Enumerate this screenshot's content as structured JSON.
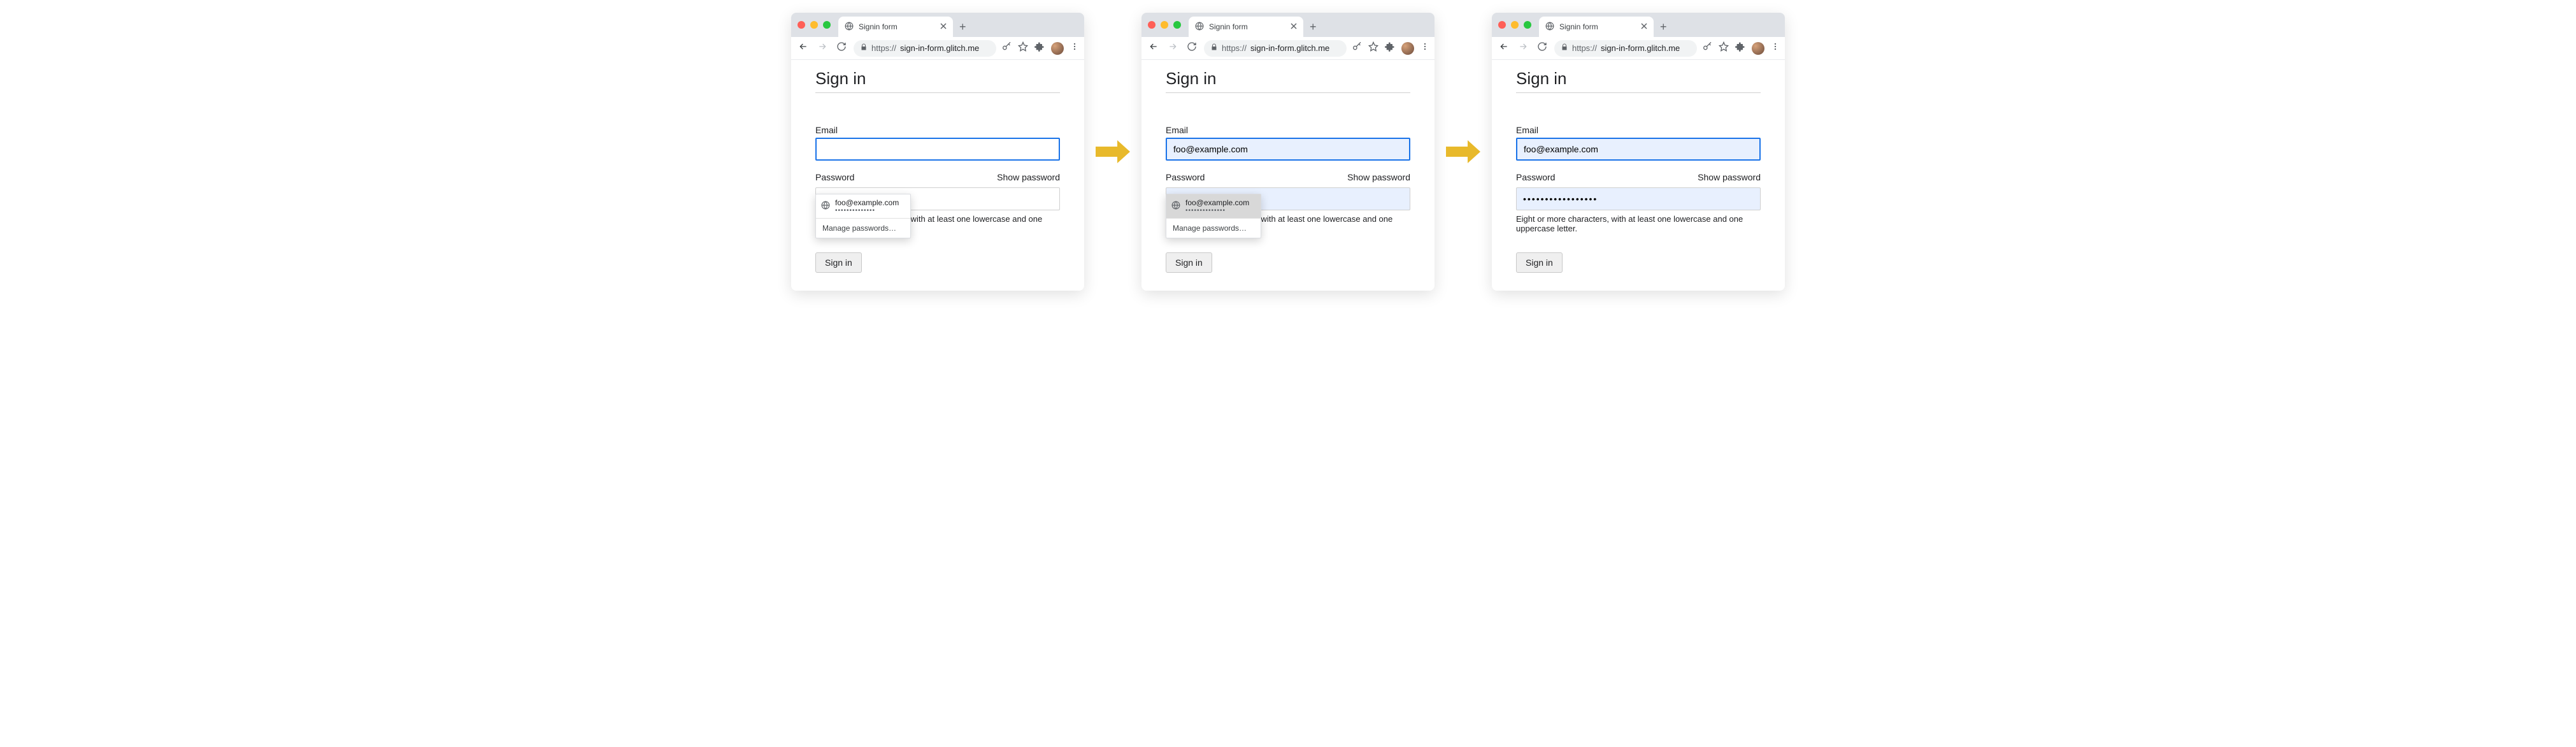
{
  "browser": {
    "tab_title": "Signin form",
    "url_protocol": "https://",
    "url_host": "sign-in-form.glitch.me"
  },
  "page": {
    "heading": "Sign in",
    "email_label": "Email",
    "password_label": "Password",
    "show_password": "Show password",
    "hint": "Eight or more characters, with at least one lowercase and one uppercase letter.",
    "submit_label": "Sign in"
  },
  "autofill": {
    "suggestion_email": "foo@example.com",
    "suggestion_dots": "••••••••••••••",
    "manage_label": "Manage passwords…"
  },
  "state1": {
    "email_value": "",
    "password_value": ""
  },
  "state2": {
    "email_value": "foo@example.com",
    "password_value": ""
  },
  "state3": {
    "email_value": "foo@example.com",
    "password_value": "•••••••••••••••••"
  }
}
